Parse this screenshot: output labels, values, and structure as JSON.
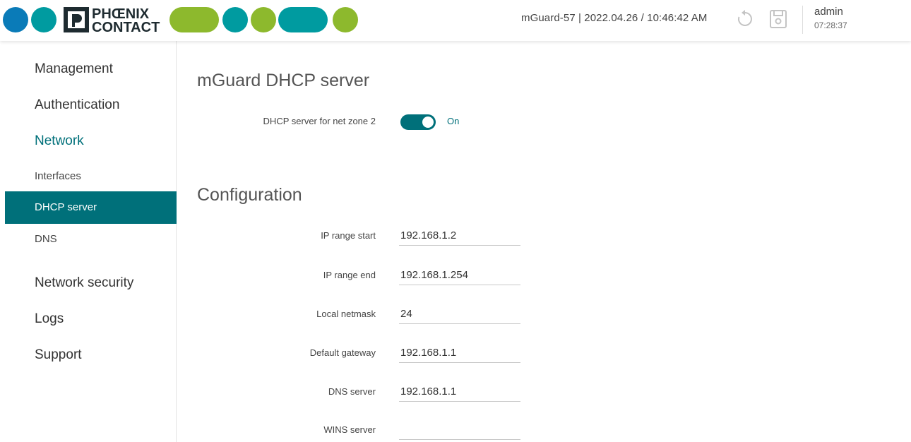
{
  "brand": {
    "name": "PHOENIX CONTACT",
    "line1": "PHŒNIX",
    "line2": "CONTACT",
    "colors": {
      "blue": "#0a7bb8",
      "green": "#8db92d",
      "teal": "#009ba0",
      "dark": "#1e2b30"
    }
  },
  "header": {
    "device_info": "mGuard-57 | 2022.04.26 / 10:46:42 AM",
    "user": "admin",
    "session_time": "07:28:37",
    "reload_icon": "reload-icon",
    "save_icon": "floppy-disk-icon"
  },
  "sidebar": {
    "items": [
      {
        "label": "Management",
        "level": "top"
      },
      {
        "label": "Authentication",
        "level": "top"
      },
      {
        "label": "Network",
        "level": "top",
        "active": true
      },
      {
        "label": "Interfaces",
        "level": "sub"
      },
      {
        "label": "DHCP server",
        "level": "sub",
        "selected": true
      },
      {
        "label": "DNS",
        "level": "sub"
      },
      {
        "label": "Network security",
        "level": "top"
      },
      {
        "label": "Logs",
        "level": "top"
      },
      {
        "label": "Support",
        "level": "top"
      }
    ]
  },
  "main": {
    "dhcp_section": {
      "title": "mGuard DHCP server",
      "toggle_label": "DHCP server for net zone 2",
      "toggle_state": "On"
    },
    "config_section": {
      "title": "Configuration",
      "fields": [
        {
          "label": "IP range start",
          "value": "192.168.1.2"
        },
        {
          "label": "IP range end",
          "value": "192.168.1.254"
        },
        {
          "label": "Local netmask",
          "value": "24"
        },
        {
          "label": "Default gateway",
          "value": "192.168.1.1"
        },
        {
          "label": "DNS server",
          "value": "192.168.1.1"
        },
        {
          "label": "WINS server",
          "value": ""
        }
      ]
    }
  },
  "theme": {
    "accent": "#00707a"
  }
}
